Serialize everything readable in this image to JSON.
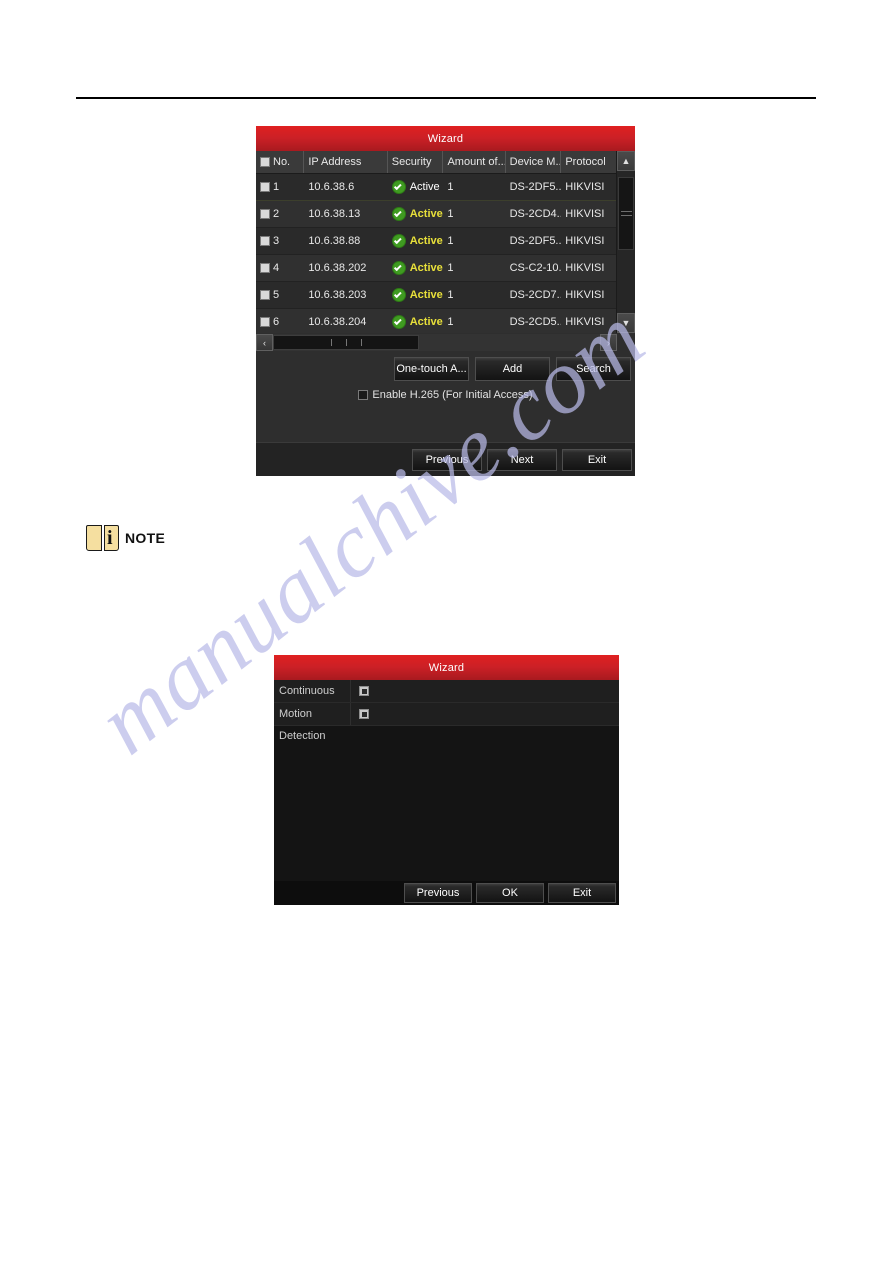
{
  "watermark": {
    "text": "manualchive.com"
  },
  "note": {
    "label": "NOTE",
    "icon": "book-info-icon",
    "letter": "i"
  },
  "dialog_camera": {
    "title": "Wizard",
    "table": {
      "select_all_checkbox": "",
      "columns": [
        "No.",
        "IP Address",
        "Security",
        "Amount of...",
        "Device M...",
        "Protocol"
      ],
      "rows": [
        {
          "no": "1",
          "ip": "10.6.38.6",
          "security": "Active",
          "amount": "1",
          "device_model": "DS-2DF5...",
          "protocol": "HIKVISI",
          "selected": true
        },
        {
          "no": "2",
          "ip": "10.6.38.13",
          "security": "Active",
          "amount": "1",
          "device_model": "DS-2CD4...",
          "protocol": "HIKVISI",
          "selected": false
        },
        {
          "no": "3",
          "ip": "10.6.38.88",
          "security": "Active",
          "amount": "1",
          "device_model": "DS-2DF5...",
          "protocol": "HIKVISI",
          "selected": false
        },
        {
          "no": "4",
          "ip": "10.6.38.202",
          "security": "Active",
          "amount": "1",
          "device_model": "CS-C2-10...",
          "protocol": "HIKVISI",
          "selected": false
        },
        {
          "no": "5",
          "ip": "10.6.38.203",
          "security": "Active",
          "amount": "1",
          "device_model": "DS-2CD7...",
          "protocol": "HIKVISI",
          "selected": false
        },
        {
          "no": "6",
          "ip": "10.6.38.204",
          "security": "Active",
          "amount": "1",
          "device_model": "DS-2CD5...",
          "protocol": "HIKVISI",
          "selected": false
        }
      ]
    },
    "actions": {
      "one_touch": "One-touch A...",
      "add": "Add",
      "search": "Search"
    },
    "h265": {
      "label": "Enable H.265 (For Initial Access)",
      "checked": false
    },
    "footer": {
      "previous": "Previous",
      "next": "Next",
      "exit": "Exit"
    },
    "scroll": {
      "up": "▲",
      "down": "▼",
      "left": "‹",
      "right": "›"
    }
  },
  "dialog_record": {
    "title": "Wizard",
    "options": [
      {
        "label": "Continuous",
        "checked": true
      },
      {
        "label": "Motion Detection",
        "checked": true
      }
    ],
    "footer": {
      "previous": "Previous",
      "ok": "OK",
      "exit": "Exit"
    }
  },
  "colors": {
    "title_red": "#cb2026",
    "status_active": "#e8e03a",
    "selected_row": "#585b40",
    "watermark": "#b9bbe8"
  }
}
